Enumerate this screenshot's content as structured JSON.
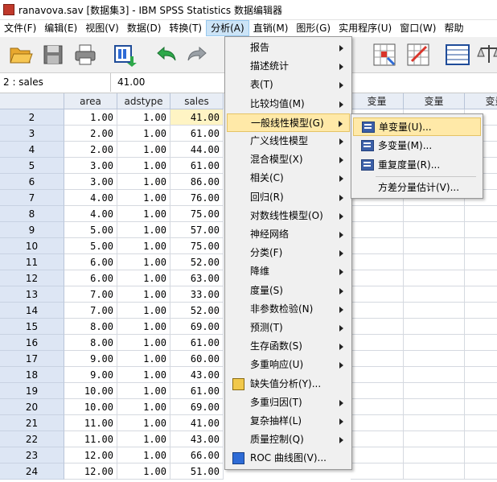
{
  "window": {
    "title": "ranavova.sav [数据集3] - IBM SPSS Statistics 数据编辑器"
  },
  "menubar": [
    "文件(F)",
    "编辑(E)",
    "视图(V)",
    "数据(D)",
    "转换(T)",
    "分析(A)",
    "直销(M)",
    "图形(G)",
    "实用程序(U)",
    "窗口(W)",
    "帮助"
  ],
  "active_menu": "分析(A)",
  "toolbar": {
    "icons": [
      "open-folder-icon",
      "save-icon",
      "print-icon",
      "recall-dialog-icon",
      "undo-icon",
      "redo-icon",
      "weight-cases-icon",
      "select-cases-icon",
      "value-labels-icon",
      "balance-icon"
    ]
  },
  "cell_editor": {
    "ref": "2 : sales",
    "value": "41.00"
  },
  "grid": {
    "columns": [
      "area",
      "adstype",
      "sales"
    ],
    "empty_columns": [
      "变量",
      "变量",
      "变量"
    ],
    "rows": [
      {
        "n": "2",
        "area": "1.00",
        "adstype": "1.00",
        "sales": "41.00"
      },
      {
        "n": "3",
        "area": "2.00",
        "adstype": "1.00",
        "sales": "61.00"
      },
      {
        "n": "4",
        "area": "2.00",
        "adstype": "1.00",
        "sales": "44.00"
      },
      {
        "n": "5",
        "area": "3.00",
        "adstype": "1.00",
        "sales": "61.00"
      },
      {
        "n": "6",
        "area": "3.00",
        "adstype": "1.00",
        "sales": "86.00"
      },
      {
        "n": "7",
        "area": "4.00",
        "adstype": "1.00",
        "sales": "76.00"
      },
      {
        "n": "8",
        "area": "4.00",
        "adstype": "1.00",
        "sales": "75.00"
      },
      {
        "n": "9",
        "area": "5.00",
        "adstype": "1.00",
        "sales": "57.00"
      },
      {
        "n": "10",
        "area": "5.00",
        "adstype": "1.00",
        "sales": "75.00"
      },
      {
        "n": "11",
        "area": "6.00",
        "adstype": "1.00",
        "sales": "52.00"
      },
      {
        "n": "12",
        "area": "6.00",
        "adstype": "1.00",
        "sales": "63.00"
      },
      {
        "n": "13",
        "area": "7.00",
        "adstype": "1.00",
        "sales": "33.00"
      },
      {
        "n": "14",
        "area": "7.00",
        "adstype": "1.00",
        "sales": "52.00"
      },
      {
        "n": "15",
        "area": "8.00",
        "adstype": "1.00",
        "sales": "69.00"
      },
      {
        "n": "16",
        "area": "8.00",
        "adstype": "1.00",
        "sales": "61.00"
      },
      {
        "n": "17",
        "area": "9.00",
        "adstype": "1.00",
        "sales": "60.00"
      },
      {
        "n": "18",
        "area": "9.00",
        "adstype": "1.00",
        "sales": "43.00"
      },
      {
        "n": "19",
        "area": "10.00",
        "adstype": "1.00",
        "sales": "61.00"
      },
      {
        "n": "20",
        "area": "10.00",
        "adstype": "1.00",
        "sales": "69.00"
      },
      {
        "n": "21",
        "area": "11.00",
        "adstype": "1.00",
        "sales": "41.00"
      },
      {
        "n": "22",
        "area": "11.00",
        "adstype": "1.00",
        "sales": "43.00"
      },
      {
        "n": "23",
        "area": "12.00",
        "adstype": "1.00",
        "sales": "66.00"
      },
      {
        "n": "24",
        "area": "12.00",
        "adstype": "1.00",
        "sales": "51.00"
      }
    ]
  },
  "analyze_menu": [
    {
      "label": "报告",
      "submenu": true
    },
    {
      "label": "描述统计",
      "submenu": true
    },
    {
      "label": "表(T)",
      "submenu": true
    },
    {
      "label": "比较均值(M)",
      "submenu": true
    },
    {
      "label": "一般线性模型(G)",
      "submenu": true,
      "highlighted": true
    },
    {
      "label": "广义线性模型",
      "submenu": true
    },
    {
      "label": "混合模型(X)",
      "submenu": true
    },
    {
      "label": "相关(C)",
      "submenu": true
    },
    {
      "label": "回归(R)",
      "submenu": true
    },
    {
      "label": "对数线性模型(O)",
      "submenu": true
    },
    {
      "label": "神经网络",
      "submenu": true
    },
    {
      "label": "分类(F)",
      "submenu": true
    },
    {
      "label": "降维",
      "submenu": true
    },
    {
      "label": "度量(S)",
      "submenu": true
    },
    {
      "label": "非参数检验(N)",
      "submenu": true
    },
    {
      "label": "预测(T)",
      "submenu": true
    },
    {
      "label": "生存函数(S)",
      "submenu": true
    },
    {
      "label": "多重响应(U)",
      "submenu": true
    },
    {
      "label": "缺失值分析(Y)...",
      "submenu": false,
      "icon": "missing-values-icon"
    },
    {
      "label": "多重归因(T)",
      "submenu": true
    },
    {
      "label": "复杂抽样(L)",
      "submenu": true
    },
    {
      "label": "质量控制(Q)",
      "submenu": true
    },
    {
      "label": "ROC 曲线图(V)...",
      "submenu": false,
      "icon": "roc-curve-icon"
    }
  ],
  "glm_submenu": [
    {
      "label": "单变量(U)...",
      "highlighted": true
    },
    {
      "label": "多变量(M)..."
    },
    {
      "label": "重复度量(R)..."
    },
    {
      "label": "方差分量估计(V)..."
    }
  ],
  "colors": {
    "highlight": "#ffe9a8",
    "selected_cell": "#fff4c4",
    "header": "#e8edf5"
  }
}
